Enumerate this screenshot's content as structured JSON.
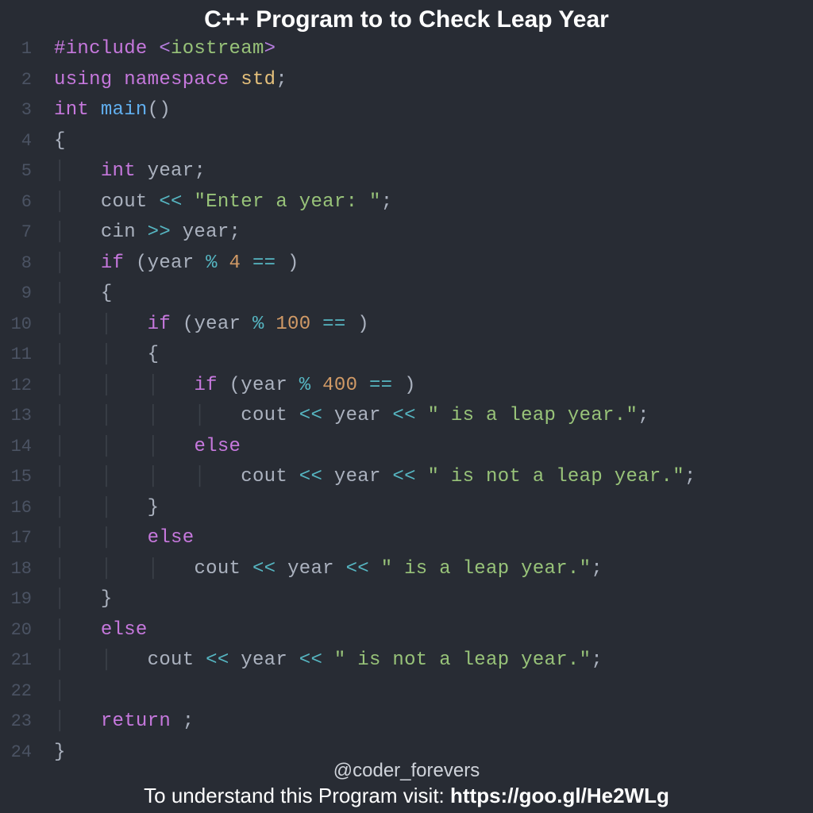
{
  "title": "C++ Program to to Check Leap Year",
  "handle": "@coder_forevers",
  "footer_prefix": "To understand this Program visit: ",
  "footer_link": "https://goo.gl/He2WLg",
  "line_numbers": [
    "1",
    "2",
    "3",
    "4",
    "5",
    "6",
    "7",
    "8",
    "9",
    "10",
    "11",
    "12",
    "13",
    "14",
    "15",
    "16",
    "17",
    "18",
    "19",
    "20",
    "21",
    "22",
    "23",
    "24"
  ],
  "code": {
    "l1": {
      "include": "#include",
      "lt": " <",
      "hdr": "iostream",
      "gt": ">"
    },
    "l2": {
      "using": "using",
      "namespace": "namespace",
      "std": "std",
      "semi": ";"
    },
    "l3": {
      "int": "int",
      "main": "main",
      "paren": "()"
    },
    "l4": {
      "brace": "{"
    },
    "l5": {
      "int": "int",
      "year": "year",
      "semi": ";"
    },
    "l6": {
      "cout": "cout",
      "op": "<<",
      "str": "\"Enter a year: \"",
      "semi": ";"
    },
    "l7": {
      "cin": "cin",
      "op": ">>",
      "year": "year",
      "semi": ";"
    },
    "l8": {
      "if": "if",
      "lp": " (",
      "year": "year",
      "mod": "%",
      "n": "4",
      "eq": "==",
      "rp": " )"
    },
    "l9": {
      "brace": "{"
    },
    "l10": {
      "if": "if",
      "lp": " (",
      "year": "year",
      "mod": "%",
      "n": "100",
      "eq": "==",
      "rp": " )"
    },
    "l11": {
      "brace": "{"
    },
    "l12": {
      "if": "if",
      "lp": " (",
      "year": "year",
      "mod": "%",
      "n": "400",
      "eq": "==",
      "rp": " )"
    },
    "l13": {
      "cout": "cout",
      "op": "<<",
      "year": "year",
      "str": "\" is a leap year.\"",
      "semi": ";"
    },
    "l14": {
      "else": "else"
    },
    "l15": {
      "cout": "cout",
      "op": "<<",
      "year": "year",
      "str": "\" is not a leap year.\"",
      "semi": ";"
    },
    "l16": {
      "brace": "}"
    },
    "l17": {
      "else": "else"
    },
    "l18": {
      "cout": "cout",
      "op": "<<",
      "year": "year",
      "str": "\" is a leap year.\"",
      "semi": ";"
    },
    "l19": {
      "brace": "}"
    },
    "l20": {
      "else": "else"
    },
    "l21": {
      "cout": "cout",
      "op": "<<",
      "year": "year",
      "str": "\" is not a leap year.\"",
      "semi": ";"
    },
    "l22": {
      "blank": ""
    },
    "l23": {
      "return": "return",
      "semi": ";"
    },
    "l24": {
      "brace": "}"
    }
  }
}
